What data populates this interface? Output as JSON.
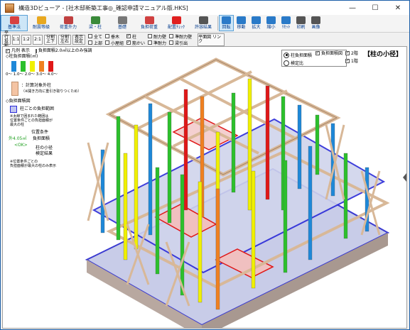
{
  "window": {
    "title": "構造3Dビューア - [社木邸新築工事◎_確認申請マニュアル版.HKS]",
    "controls": {
      "minimize": "—",
      "maximize": "☐",
      "close": "✕"
    }
  },
  "toolbar": {
    "items": [
      {
        "label": "基準法",
        "icon": "kijunho-icon",
        "color": "#d84040",
        "active": true
      },
      {
        "label": "耐震等級",
        "icon": "stars-icon",
        "color": "#e8a820",
        "active": false
      },
      {
        "label": "荷重外力",
        "icon": "load-icon",
        "color": "#c04040",
        "active": false
      },
      {
        "label": "梁・柱",
        "icon": "beam-icon",
        "color": "#3a8a3a",
        "active": false
      },
      {
        "label": "基礎",
        "icon": "foundation-icon",
        "color": "#777777",
        "active": false
      },
      {
        "label": "負担荷重",
        "icon": "weight-icon",
        "color": "#d04040",
        "active": false
      },
      {
        "label": "配置ﾁｪｯｸ",
        "icon": "check-icon",
        "color": "#e02020",
        "active": false
      },
      {
        "label": "許容結果",
        "icon": "result-icon",
        "color": "#555555",
        "active": false
      },
      {
        "label": "回転",
        "icon": "rotate-icon",
        "color": "#2a7ac8",
        "active": true
      },
      {
        "label": "移動",
        "icon": "move-icon",
        "color": "#2a7ac8",
        "active": false
      },
      {
        "label": "拡大",
        "icon": "zoom-in-icon",
        "color": "#2a7ac8",
        "active": false
      },
      {
        "label": "縮小",
        "icon": "zoom-out-icon",
        "color": "#2a7ac8",
        "active": false
      },
      {
        "label": "ﾘｾｯﾄ",
        "icon": "reset-icon",
        "color": "#2a7ac8",
        "active": false
      },
      {
        "label": "印刷",
        "icon": "print-icon",
        "color": "#555555",
        "active": false
      },
      {
        "label": "画像",
        "icon": "image-icon",
        "color": "#555555",
        "active": false
      }
    ]
  },
  "subtoolbar": {
    "buttons": [
      "平行 投影",
      "1:1",
      "1:2",
      "2:1",
      "分割 上下",
      "分割 左右",
      "表示 設定"
    ],
    "checks": [
      {
        "label": "全て",
        "checked": false
      },
      {
        "label": "上部",
        "checked": false
      },
      {
        "label": "垂木",
        "checked": false
      },
      {
        "label": "小屋組",
        "checked": false
      },
      {
        "label": "柱",
        "checked": true
      },
      {
        "label": "筋かい",
        "checked": true
      },
      {
        "label": "耐力壁",
        "checked": false
      },
      {
        "label": "準耐力",
        "checked": false
      },
      {
        "label": "準耐力壁",
        "checked": false
      },
      {
        "label": "梁引出",
        "checked": false
      }
    ],
    "plan_link": "平面図 リンク"
  },
  "legend": {
    "show_legend": {
      "label": "凡例 表示",
      "checked": true
    },
    "area_filter": {
      "label": "負担面積2.0㎡以上のみ強調",
      "checked": false
    },
    "header": "◇柱負担面積(㎡)",
    "colors": [
      "#1e88d8",
      "#2cc02c",
      "#f0f000",
      "#f08020",
      "#e01818"
    ],
    "scale_label": "0～  1.0～ 2.0～ 3.0～ 4.0～",
    "calc_column": "：計算対象外柱",
    "calc_column_note": "（※開き方向に重引き取りつくため）",
    "burden_header": "◇負担面積図",
    "burden_item": "柱ごとの負担範囲",
    "note1": "※太線で囲まれた範囲は",
    "note2": "位置条件ごとの負担面積が",
    "note3": "最大の柱",
    "position_condition": "位置条件",
    "example_value": "外4.05㎡",
    "burden_area": "負担面積",
    "example_result": "<OK>",
    "small_diameter": "柱の小径",
    "check_result": "検定結果",
    "note4": "※位置条件ごとの",
    "note5": "負担面積が最大の柱のみ表示"
  },
  "select_panel": {
    "options": [
      {
        "label": "柱負担面積",
        "selected": true
      },
      {
        "label": "検定比",
        "selected": false
      }
    ]
  },
  "right_panel": {
    "burden_check": {
      "label": "負担面積図",
      "checked": true
    },
    "floors": [
      {
        "label": "2階",
        "checked": true
      },
      {
        "label": "1階",
        "checked": true
      }
    ]
  },
  "view_tag": "【柱の小径】"
}
